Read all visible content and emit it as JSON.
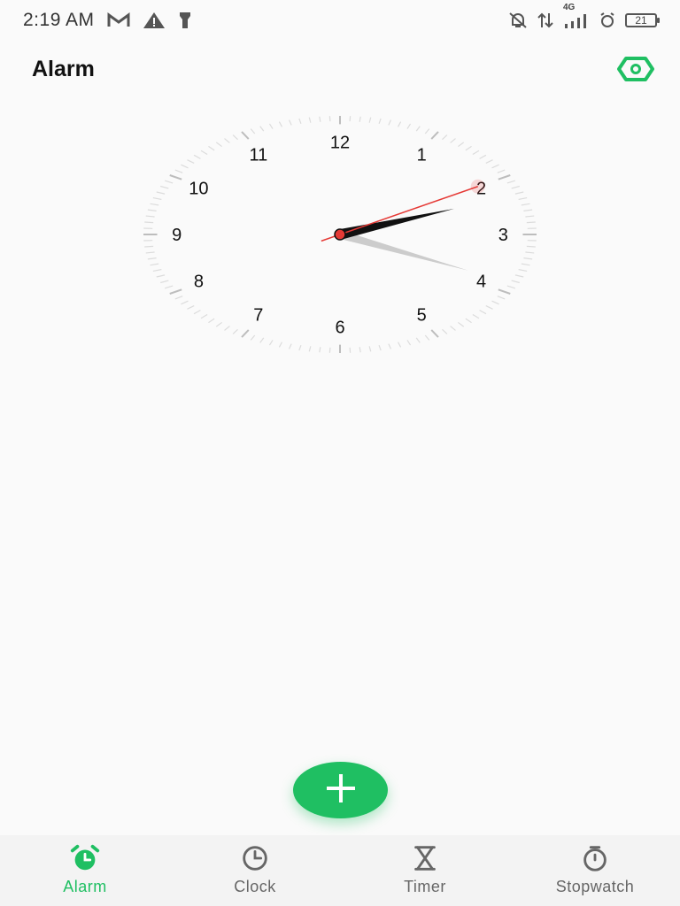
{
  "status_bar": {
    "time": "2:19 AM",
    "network": "4G",
    "battery": "21",
    "icons": [
      "gmail-icon",
      "warning-icon",
      "flashlight-icon",
      "bell-off-icon",
      "data-arrows-icon",
      "signal-icon",
      "alarm-set-icon",
      "battery-icon"
    ]
  },
  "header": {
    "title": "Alarm",
    "settings_icon": "settings-hex-icon"
  },
  "clock": {
    "numbers": [
      "12",
      "1",
      "2",
      "3",
      "4",
      "5",
      "6",
      "7",
      "8",
      "9",
      "10",
      "11"
    ],
    "time": {
      "hour": 2,
      "minute": 19,
      "second": 10
    },
    "colors": {
      "second_hand": "#e53935",
      "hour_hand": "#111111",
      "minute_hand": "#cccccc"
    }
  },
  "fab": {
    "icon": "plus-icon",
    "color": "#1fbf62"
  },
  "bottom_nav": {
    "items": [
      {
        "label": "Alarm",
        "icon": "alarm-clock-icon",
        "active": true
      },
      {
        "label": "Clock",
        "icon": "clock-icon",
        "active": false
      },
      {
        "label": "Timer",
        "icon": "hourglass-icon",
        "active": false
      },
      {
        "label": "Stopwatch",
        "icon": "stopwatch-icon",
        "active": false
      }
    ]
  },
  "accent_color": "#1fbf62"
}
